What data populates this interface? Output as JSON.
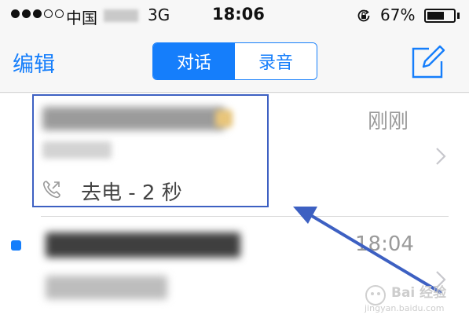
{
  "status_bar": {
    "carrier": "中国",
    "network": "3G",
    "time": "18:06",
    "battery_percent": "67%",
    "battery_level": 0.67
  },
  "nav_bar": {
    "edit_label": "编辑",
    "segments": [
      {
        "label": "对话",
        "active": true
      },
      {
        "label": "录音",
        "active": false
      }
    ],
    "compose_icon": "compose-icon"
  },
  "conversations": [
    {
      "time": "刚刚",
      "call_detail": "去电 - 2 秒",
      "unread": false
    },
    {
      "time": "18:04",
      "unread": true
    }
  ],
  "watermark": {
    "text": "Bai 经验",
    "sub": "jingyan.baidu.com"
  },
  "colors": {
    "accent": "#157efb",
    "annotation": "#3d60c2",
    "secondary_text": "#9a9a9a"
  }
}
